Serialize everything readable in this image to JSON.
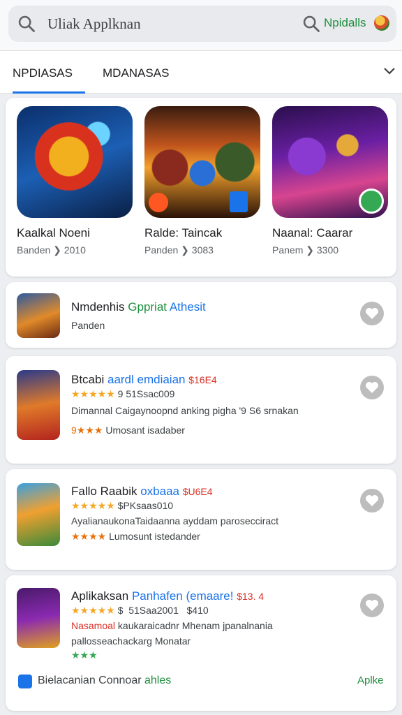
{
  "search": {
    "text": "Uliak Applknan",
    "right_label": "Npidalls"
  },
  "tabs": {
    "tab1": "NPDIASAS",
    "tab2": "MDANASAS"
  },
  "featured": [
    {
      "title": "Kaalkal Noeni",
      "sub": "Banden ❯ 2010"
    },
    {
      "title": "Ralde: Taincak",
      "sub": "Panden ❯ 3083"
    },
    {
      "title": "Naanal: Caarar",
      "sub": "Panem ❯ 3300"
    }
  ],
  "list": [
    {
      "title_a": "Nmdenhis ",
      "title_b": "Gppriat ",
      "title_c": "Athesit",
      "sub": "Panden"
    },
    {
      "title_a": "Btcabi ",
      "title_b": "aardl emdiaian",
      "price": "$16E4",
      "stars": "★★★★★",
      "rating_text": "9 51Ssac009",
      "desc": "Dimannal Caigaynoopnd anking pigha '9 S6 srnakan",
      "stars2": "9★★★",
      "note": "Umosant isadaber"
    },
    {
      "title_a": "Fallo Raabik ",
      "title_b": "oxbaaa",
      "price": "$U6E4",
      "stars": "★★★★★",
      "rating_text": "$PKsaas010",
      "desc": "AyalianaukonaTaidaanna ayddam parosecciract",
      "stars2": "★★★★",
      "note": "Lumosunt istedander"
    },
    {
      "title_a": "Aplikaksan ",
      "title_b": "Panhafen (emaare!",
      "price": "$13. 4",
      "stars": "★★★★★",
      "rating_text": "$  51Saa2001   $410",
      "desc_red": "Nasamoal",
      "desc": " kaukaraicadnr Mhenam jpanalnania",
      "desc2": "pallosseachackarg Monatar",
      "stars2": "★★★",
      "bottom_label_a": "Bielacanian ",
      "bottom_label_b": "Connoar ",
      "bottom_label_c": "ahles",
      "bottom_right": "Aplke"
    }
  ],
  "colors": {
    "accent": "#1a73e8",
    "green": "#1e8e3e",
    "star": "#f5a623",
    "red": "#d93025"
  }
}
